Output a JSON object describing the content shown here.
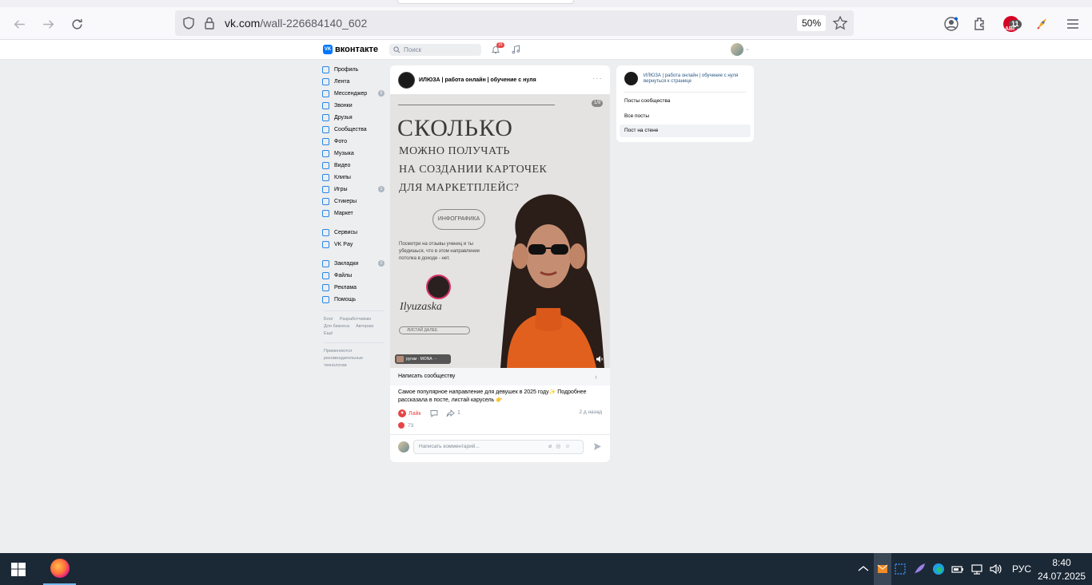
{
  "browser": {
    "url_host": "vk.com",
    "url_path": "/wall-226684140_602",
    "zoom": "50%",
    "ext_badge": "11",
    "ext_badge_sub": "АВГ"
  },
  "vk_header": {
    "logo_text": "вконтакте",
    "logo_mark": "VK",
    "search_placeholder": "Поиск",
    "notif_count": "15"
  },
  "left_menu": {
    "items": [
      {
        "label": "Профиль",
        "count": ""
      },
      {
        "label": "Лента",
        "count": ""
      },
      {
        "label": "Мессенджер",
        "count": "5"
      },
      {
        "label": "Звонки",
        "count": ""
      },
      {
        "label": "Друзья",
        "count": ""
      },
      {
        "label": "Сообщества",
        "count": ""
      },
      {
        "label": "Фото",
        "count": ""
      },
      {
        "label": "Музыка",
        "count": ""
      },
      {
        "label": "Видео",
        "count": ""
      },
      {
        "label": "Клипы",
        "count": ""
      },
      {
        "label": "Игры",
        "count": "1"
      },
      {
        "label": "Стикеры",
        "count": ""
      },
      {
        "label": "Маркет",
        "count": ""
      }
    ],
    "items2": [
      {
        "label": "Сервисы"
      },
      {
        "label": "VK Pay"
      }
    ],
    "items3": [
      {
        "label": "Закладки",
        "count": "2"
      },
      {
        "label": "Файлы"
      },
      {
        "label": "Реклама"
      },
      {
        "label": "Помощь"
      }
    ],
    "footer": [
      "Блог",
      "Разработчикам",
      "Для бизнеса",
      "Авторам",
      "Ещё"
    ],
    "footer_note": "Применяются рекомендательные технологии"
  },
  "post": {
    "author": "ИЛЮЗА | работа онлайн | обучение с нуля",
    "pager": "1/9",
    "slide_title": "СКОЛЬКО",
    "slide_line1": "МОЖНО ПОЛУЧАТЬ",
    "slide_line2": "НА СОЗДАНИИ КАРТОЧЕК",
    "slide_line3": "ДЛЯ МАРКЕТПЛЕЙС?",
    "slide_pill": "ИНФОГРАФИКА",
    "slide_small": "Посмотри на отзывы учениц и ты убедишься, что в этом направлении потолка в доходе - нет.",
    "slide_signature": "Ilyuzaska",
    "slide_more": "ЛИСТАЙ ДАЛЕЕ",
    "music_chip": "ругам · MONA ···",
    "write_message": "Написать сообществу",
    "text": "Самое популярное направление для девушек в 2025 году✨ Подробнее рассказала в посте, листай карусель 👉",
    "like_label": "Лайк",
    "share_count": "1",
    "time": "2 д назад",
    "likes_count": "73",
    "comment_placeholder": "Написать комментарий..."
  },
  "right_card": {
    "name": "ИЛЮЗА | работа онлайн | обучение с нуля",
    "back": "вернуться к странице",
    "items": [
      "Посты сообщества",
      "Все посты",
      "Пост на стене"
    ]
  },
  "taskbar": {
    "lang": "РУС",
    "time": "8:40",
    "date": "24.07.2025"
  }
}
